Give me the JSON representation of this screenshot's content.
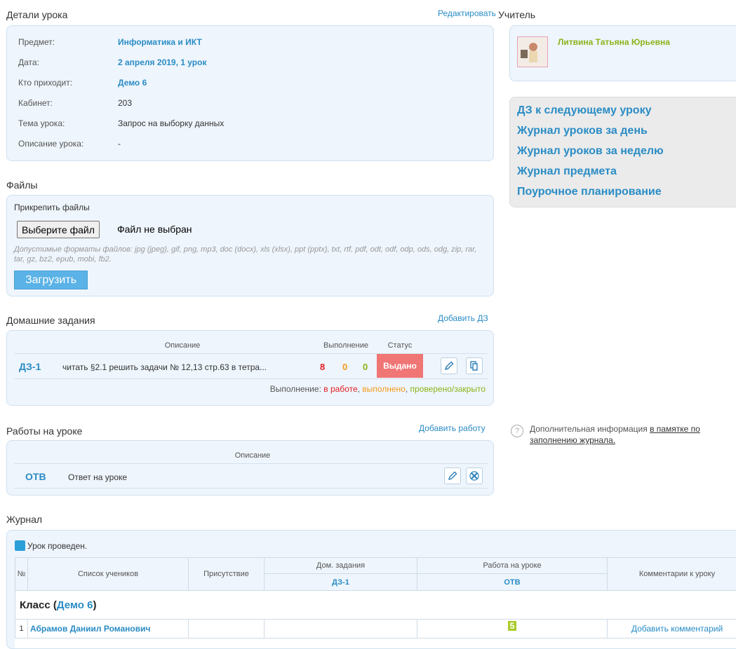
{
  "lesson_details": {
    "title": "Детали урока",
    "edit_label": "Редактировать",
    "rows": [
      {
        "label": "Предмет:",
        "value": "Информатика и ИКТ"
      },
      {
        "label": "Дата:",
        "value": "2 апреля 2019, 1 урок"
      },
      {
        "label": "Кто приходит:",
        "value": "Демо 6"
      },
      {
        "label": "Кабинет:",
        "value": "203"
      },
      {
        "label": "Тема урока:",
        "value": "Запрос на выборку данных"
      },
      {
        "label": "Описание урока:",
        "value": "-"
      }
    ]
  },
  "files": {
    "title": "Файлы",
    "attach_label": "Прикрепить файлы",
    "choose_label": "Выберите файл",
    "none_label": "Файл не выбран",
    "formats_text": "Допустимые форматы файлов: jpg (jpeg), gif, png, mp3, doc (docx), xls (xlsx), ppt (pptx), txt, rtf, pdf, odt, odf, odp, ods, odg, zip, rar, tar, gz, bz2, epub, mobi, fb2.",
    "upload_label": "Загрузить"
  },
  "homework": {
    "title": "Домашние задания",
    "add_label": "Добавить ДЗ",
    "headers": {
      "description": "Описание",
      "progress": "Выполнение",
      "status": "Статус"
    },
    "row": {
      "code": "ДЗ-1",
      "description": "читать §2.1 решить задачи № 12,13 стр.63 в тетра...",
      "in_work": "8",
      "done": "0",
      "checked": "0",
      "status": "Выдано"
    },
    "legend": {
      "prefix": "Выполнение:",
      "in_work": "в работе",
      "done": "выполнено",
      "checked": "проверено/закрыто"
    },
    "colors": {
      "in_work": "#e02020",
      "done": "#f59a1a",
      "checked": "#8cb319"
    }
  },
  "lesson_work": {
    "title": "Работы на уроке",
    "add_label": "Добавить работу",
    "header_description": "Описание",
    "row": {
      "code": "ОТВ",
      "description": "Ответ на уроке"
    }
  },
  "teacher": {
    "title": "Учитель",
    "name": "Литвина Татьяна Юрьевна"
  },
  "quick_links": [
    "ДЗ к следующему уроку",
    "Журнал уроков за день",
    "Журнал уроков за неделю",
    "Журнал предмета",
    "Поурочное планирование"
  ],
  "info": {
    "text": "Дополнительная информация",
    "link_part1": "в памятке по",
    "link_part2": "заполнению журнала."
  },
  "journal": {
    "title": "Журнал",
    "lesson_done": "Урок проведен.",
    "headers": {
      "num": "№",
      "students": "Список учеников",
      "attendance": "Присутствие",
      "homework": "Дом. задания",
      "homework_sub": "ДЗ-1",
      "lesson_work": "Работа на уроке",
      "lesson_work_sub": "ОТВ",
      "comments": "Комментарии к уроку"
    },
    "class_prefix": "Класс (",
    "class_name": "Демо 6",
    "class_suffix": ")",
    "students": [
      {
        "num": "1",
        "name": "Абрамов Даниил Романович",
        "grade": "5",
        "comment": "Добавить комментарий"
      }
    ]
  }
}
